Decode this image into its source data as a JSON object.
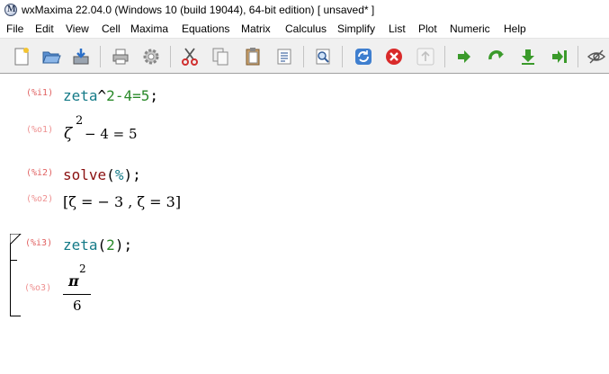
{
  "window": {
    "title": "wxMaxima 22.04.0 (Windows 10 (build 19044), 64-bit edition) [ unsaved* ]",
    "app_icon_letter": "M"
  },
  "menu": {
    "items": [
      "File",
      "Edit",
      "View",
      "Cell",
      "Maxima",
      "Equations",
      "Matrix",
      "Calculus",
      "Simplify",
      "List",
      "Plot",
      "Numeric",
      "Help"
    ]
  },
  "toolbar": {
    "buttons": [
      "new-icon",
      "open-icon",
      "save-icon",
      "print-icon",
      "settings-icon",
      "cut-icon",
      "copy-icon",
      "paste-icon",
      "select-all-icon",
      "find-icon",
      "restart-icon",
      "interrupt-icon",
      "follow-icon",
      "evaluate-icon",
      "evaluate-step-icon",
      "evaluate-all-icon",
      "evaluate-to-end-icon",
      "hide-icon"
    ]
  },
  "cells": [
    {
      "input_label": "(%i1)",
      "input": {
        "fn": "zeta",
        "rest_op": "^",
        "n1": "2",
        "op1": "-",
        "n2": "4",
        "op2": "=",
        "n3": "5",
        "end": ";"
      },
      "output_label": "(%o1)",
      "output": {
        "sym": "ζ",
        "exp": "2",
        "rest": "− 4 = 5"
      }
    },
    {
      "input_label": "(%i2)",
      "input": {
        "fn": "solve",
        "open": "(",
        "arg": "%",
        "close": ")",
        "end": ";"
      },
      "output_label": "(%o2)",
      "output": {
        "text": "[ζ = − 3 , ζ = 3]"
      }
    },
    {
      "input_label": "(%i3)",
      "input": {
        "fn": "zeta",
        "open": "(",
        "arg": "2",
        "close": ")",
        "end": ";"
      },
      "output_label": "(%o3)",
      "output": {
        "numerator": "π",
        "exp": "2",
        "denominator": "6"
      }
    }
  ],
  "colors": {
    "label_input": "#e06060",
    "label_output": "#ee9090",
    "function": "#147a87",
    "number": "#2a8a2a",
    "keyword": "#8a1010"
  }
}
